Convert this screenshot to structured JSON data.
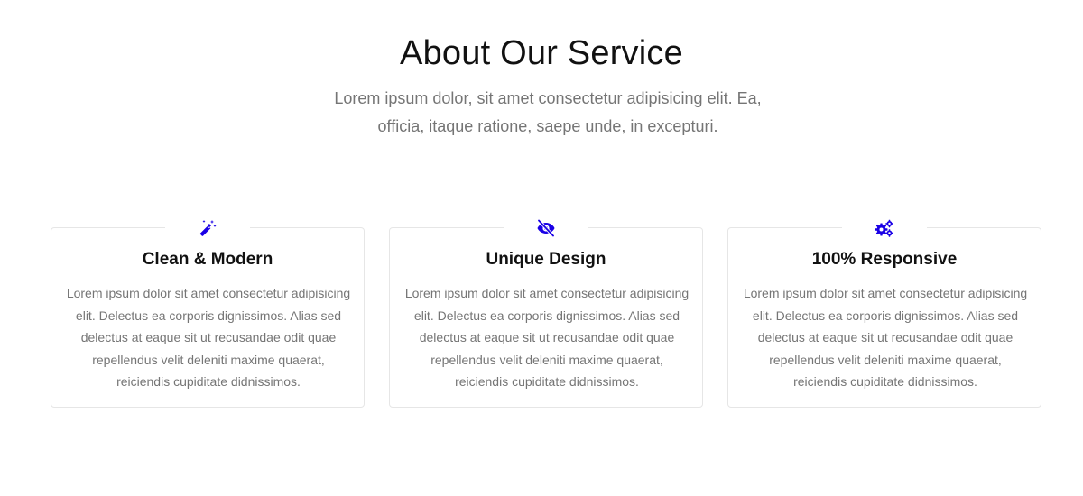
{
  "section": {
    "title": "About Our Service",
    "subtitle": "Lorem ipsum dolor, sit amet consectetur adipisicing elit. Ea, officia, itaque ratione, saepe unde, in excepturi."
  },
  "accent_color": "#1a00e6",
  "cards": [
    {
      "icon": "magic-wand-icon",
      "title": "Clean & Modern",
      "text": "Lorem ipsum dolor sit amet consectetur adipisicing elit. Delectus ea corporis dignissimos. Alias sed delectus at eaque sit ut recusandae odit quae repellendus velit deleniti maxime quaerat, reiciendis cupiditate didnissimos."
    },
    {
      "icon": "eye-slash-icon",
      "title": "Unique Design",
      "text": "Lorem ipsum dolor sit amet consectetur adipisicing elit. Delectus ea corporis dignissimos. Alias sed delectus at eaque sit ut recusandae odit quae repellendus velit deleniti maxime quaerat, reiciendis cupiditate didnissimos."
    },
    {
      "icon": "gears-icon",
      "title": "100% Responsive",
      "text": "Lorem ipsum dolor sit amet consectetur adipisicing elit. Delectus ea corporis dignissimos. Alias sed delectus at eaque sit ut recusandae odit quae repellendus velit deleniti maxime quaerat, reiciendis cupiditate didnissimos."
    }
  ]
}
